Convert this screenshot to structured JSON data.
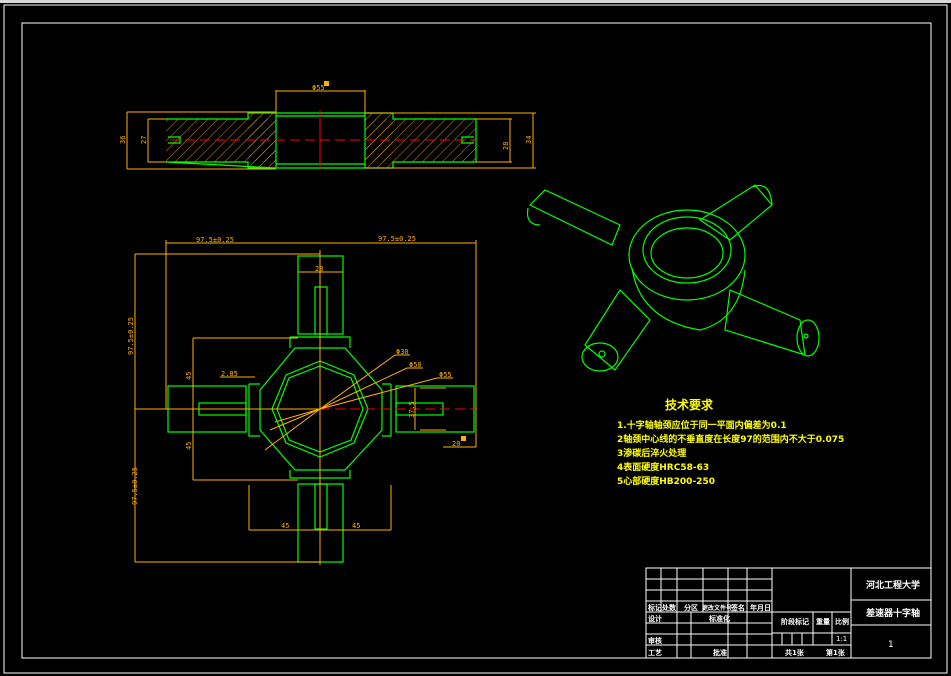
{
  "colors": {
    "background": "#000000",
    "outline": "#00ff00",
    "dimension": "#ffb000",
    "centerline": "#ff0000",
    "text": "#ffff00",
    "frame": "#ffffff"
  },
  "section_view": {
    "dims": {
      "hub_dia": "Φ55",
      "height_left_outer": "36",
      "height_left_inner": "27",
      "height_right_inner": "28",
      "height_right_outer": "34"
    }
  },
  "plan_view": {
    "dims": {
      "half_width_left": "97.5±0.25",
      "half_width_right": "97.5±0.25",
      "half_height_top": "97.5±0.25",
      "half_height_bottom": "97.5±0.25",
      "journal_width": "28",
      "arm_upper": "45",
      "arm_lower": "45",
      "bottom_left": "45",
      "bottom_right": "45",
      "chamfer": "2.85",
      "dia_30": "Φ30",
      "dia_50": "Φ50",
      "dia_55": "Φ55",
      "journal_dia": "37.5",
      "journal_len": "20"
    }
  },
  "requirements": {
    "title": "技术要求",
    "items": [
      "1.十字轴轴颈应位于同一平面内偏差为0.1",
      "2轴颈中心线的不垂直度在长度97的范围内不大于0.075",
      "3渗碳后淬火处理",
      "4表面硬度HRC58-63",
      "5心部硬度HB200-250"
    ]
  },
  "title_block": {
    "school": "河北工程大学",
    "part_name": "差速器十字轴",
    "drawing_no": "1",
    "headers": [
      "标记",
      "处数",
      "分区",
      "更改文件号",
      "签名",
      "年月日"
    ],
    "rows": [
      "设计",
      "审核",
      "工艺"
    ],
    "standardize": "标准化",
    "approve": "批准",
    "stage_mark": "阶段标记",
    "weight": "重量",
    "scale_label": "比例",
    "scale": "1:1",
    "sheets_total": "共1张",
    "sheet_no": "第1张"
  }
}
